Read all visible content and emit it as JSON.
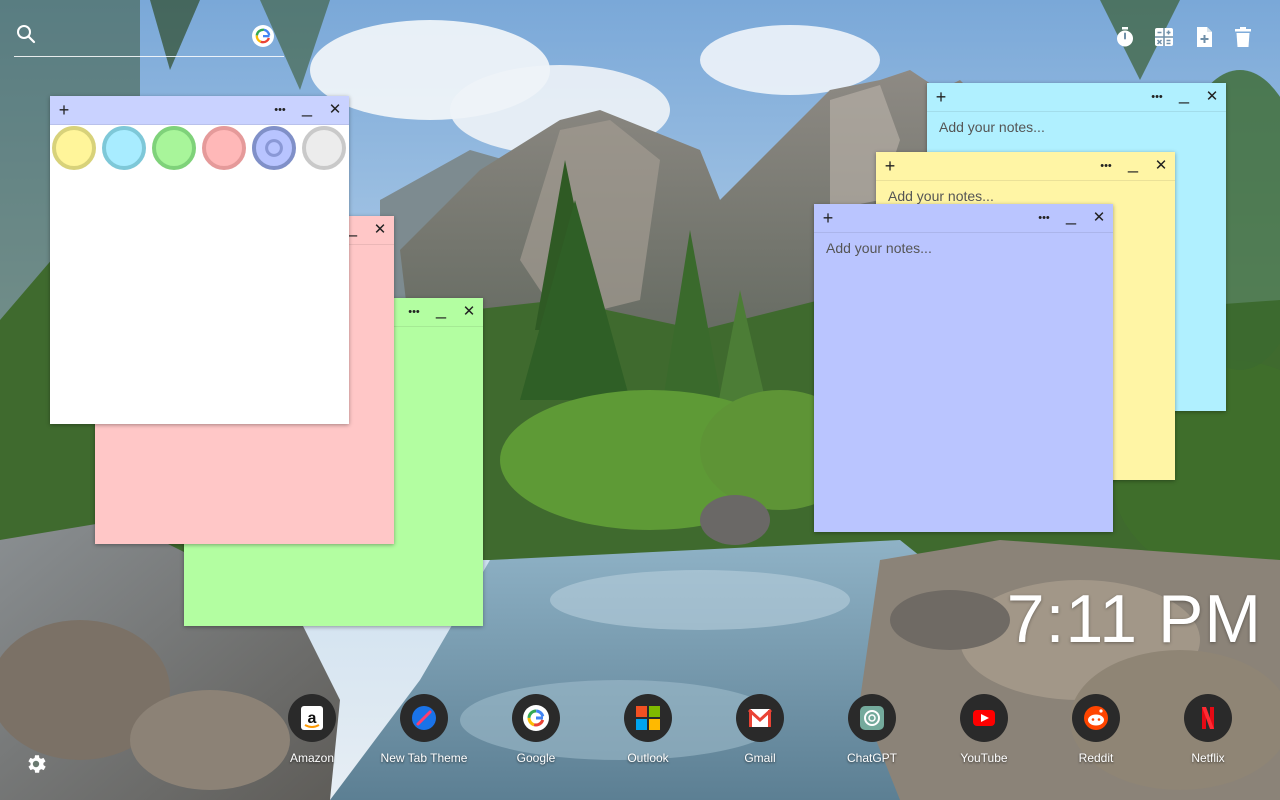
{
  "search": {
    "placeholder": ""
  },
  "toolbar": {
    "icons": [
      "timer-icon",
      "calculator-icon",
      "new-note-icon",
      "trash-icon"
    ]
  },
  "notes": {
    "add_label": "+",
    "more_label": "•••",
    "minimize_label": "_",
    "close_label": "✕",
    "placeholder": "Add your notes...",
    "colors": {
      "white": "#ffffff",
      "pink": "#ffc7c7",
      "green": "#b3fea1",
      "cyan": "#b0f0ff",
      "yellow": "#fff5a5",
      "blue": "#bac5ff"
    },
    "palette": [
      {
        "name": "yellow",
        "fill": "#fff59a",
        "ring": "#d8d27a"
      },
      {
        "name": "cyan",
        "fill": "#a8ecff",
        "ring": "#7ec8d8"
      },
      {
        "name": "green",
        "fill": "#a8f59a",
        "ring": "#7fd27a"
      },
      {
        "name": "pink",
        "fill": "#ffb8b8",
        "ring": "#e59a9a"
      },
      {
        "name": "blue",
        "fill": "#b8c4ff",
        "ring": "#8090c8"
      },
      {
        "name": "gray",
        "fill": "#ececec",
        "ring": "#c9c9c9"
      }
    ]
  },
  "clock": {
    "time": "7:11 PM"
  },
  "dock": [
    {
      "label": "Amazon",
      "icon": "amazon-icon"
    },
    {
      "label": "New Tab Theme",
      "icon": "new-tab-theme-icon"
    },
    {
      "label": "Google",
      "icon": "google-icon"
    },
    {
      "label": "Outlook",
      "icon": "outlook-icon"
    },
    {
      "label": "Gmail",
      "icon": "gmail-icon"
    },
    {
      "label": "ChatGPT",
      "icon": "chatgpt-icon"
    },
    {
      "label": "YouTube",
      "icon": "youtube-icon"
    },
    {
      "label": "Reddit",
      "icon": "reddit-icon"
    },
    {
      "label": "Netflix",
      "icon": "netflix-icon"
    }
  ]
}
